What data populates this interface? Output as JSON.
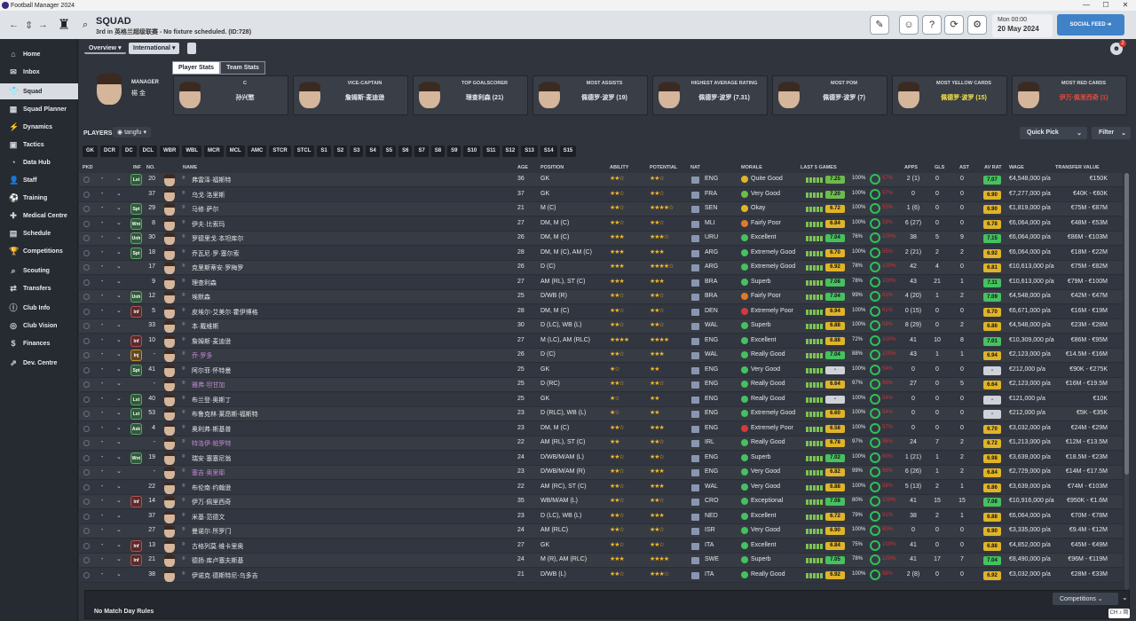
{
  "window": {
    "title": "Football Manager 2024",
    "minimize": "—",
    "maximize": "☐",
    "close": "✕"
  },
  "topbar": {
    "section": "SQUAD",
    "subtitle": "3rd in 英格兰超级联赛 - No fixture scheduled. (ID:728)",
    "date_line1": "Mon 00:00",
    "date_line2": "20 May 2024",
    "social_feed": "SOCIAL FEED"
  },
  "sidebar": {
    "items": [
      {
        "label": "Home",
        "icon": "home-icon"
      },
      {
        "label": "Inbox",
        "icon": "inbox-icon"
      },
      {
        "label": "Squad",
        "icon": "shirt-icon"
      },
      {
        "label": "Squad Planner",
        "icon": "planner-icon"
      },
      {
        "label": "Dynamics",
        "icon": "dynamics-icon"
      },
      {
        "label": "Tactics",
        "icon": "tactics-icon"
      },
      {
        "label": "Data Hub",
        "icon": "data-hub-icon"
      },
      {
        "label": "Staff",
        "icon": "staff-icon"
      },
      {
        "label": "Training",
        "icon": "training-icon"
      },
      {
        "label": "Medical Centre",
        "icon": "medical-icon"
      },
      {
        "label": "Schedule",
        "icon": "calendar-icon"
      },
      {
        "label": "Competitions",
        "icon": "trophy-icon"
      },
      {
        "label": "Scouting",
        "icon": "scouting-icon"
      },
      {
        "label": "Transfers",
        "icon": "transfers-icon"
      },
      {
        "label": "Club Info",
        "icon": "club-info-icon"
      },
      {
        "label": "Club Vision",
        "icon": "vision-icon"
      },
      {
        "label": "Finances",
        "icon": "finances-icon"
      },
      {
        "label": "Dev. Centre",
        "icon": "dev-centre-icon"
      }
    ],
    "active": "Squad"
  },
  "tabs": {
    "overview": "Overview",
    "international": "International"
  },
  "notifications": {
    "count": "2"
  },
  "manager": {
    "label": "MANAGER",
    "name": "楊 金"
  },
  "stat_tabs": {
    "player_stats": "Player Stats",
    "team_stats": "Team Stats"
  },
  "cards": [
    {
      "title": "C",
      "value": "孙兴慜",
      "color": "#e6e8ec"
    },
    {
      "title": "VICE-CAPTAIN",
      "value": "詹姆斯·麦迪逊",
      "color": "#e6e8ec"
    },
    {
      "title": "TOP GOALSCORER",
      "value": "理查利森 (21)",
      "color": "#e6e8ec"
    },
    {
      "title": "MOST ASSISTS",
      "value": "佩德罗·波罗 (19)",
      "color": "#e6e8ec"
    },
    {
      "title": "HIGHEST AVERAGE RATING",
      "value": "佩德罗·波罗 (7.31)",
      "color": "#e6e8ec"
    },
    {
      "title": "MOST POM",
      "value": "佩德罗·波罗 (7)",
      "color": "#e6e8ec"
    },
    {
      "title": "MOST YELLOW CARDS",
      "value": "佩德罗·波罗 (15)",
      "color": "#f2e24a"
    },
    {
      "title": "MOST RED CARDS",
      "value": "伊万·佩里西奇 (1)",
      "color": "#e24a3f"
    }
  ],
  "players_label": "PLAYERS",
  "players_view": "tangfu",
  "quick_pick": "Quick Pick",
  "filter": "Filter",
  "position_filters": [
    "GK",
    "DCR",
    "DC",
    "DCL",
    "WBR",
    "WBL",
    "MCR",
    "MCL",
    "AMC",
    "STCR",
    "STCL",
    "S1",
    "S2",
    "S3",
    "S4",
    "S5",
    "S6",
    "S7",
    "S8",
    "S9",
    "S10",
    "S11",
    "S12",
    "S13",
    "S14",
    "S15"
  ],
  "columns": {
    "pkd": "PKD",
    "inf": "INF",
    "no": "NO.",
    "name": "NAME",
    "age": "AGE",
    "position": "POSITION",
    "ability": "ABILITY",
    "potential": "POTENTIAL",
    "nat": "NAT",
    "morale": "MORALE",
    "last5": "LAST 5 GAMES",
    "apps": "APPS",
    "gls": "GLS",
    "ast": "AST",
    "avrat": "AV RAT",
    "wage": "WAGE",
    "tval": "TRANSFER VALUE"
  },
  "players": [
    {
      "inf": "Lst",
      "infc": "g",
      "no": "20",
      "name": "弗雷泽·福斯特",
      "link": false,
      "age": "36",
      "pos": "GK",
      "abil": "★★☆",
      "pot": "★★☆",
      "nat": "ENG",
      "morale": "Quite Good",
      "mc": "#e0b429",
      "l5": "7.25",
      "l5c": "#6dbb4c",
      "p1": "100%",
      "p2": "57%",
      "apps": "2 (1)",
      "gls": "0",
      "ast": "0",
      "avrat": "7.07",
      "arc": "#45c160",
      "wage": "€4,548,000 p/a",
      "tval": "€150K"
    },
    {
      "inf": "",
      "infc": "",
      "no": "37",
      "name": "乌戈·洛里斯",
      "link": false,
      "age": "37",
      "pos": "GK",
      "abil": "★★☆",
      "pot": "★★☆",
      "nat": "FRA",
      "morale": "Very Good",
      "mc": "#6dbb4c",
      "l5": "7.20",
      "l5c": "#6dbb4c",
      "p1": "100%",
      "p2": "57%",
      "apps": "0",
      "gls": "0",
      "ast": "0",
      "avrat": "6.90",
      "arc": "#e0b429",
      "wage": "€7,277,000 p/a",
      "tval": "€40K - €60K"
    },
    {
      "inf": "Spt",
      "infc": "g",
      "no": "29",
      "name": "马修·萨尔",
      "link": false,
      "age": "21",
      "pos": "M (C)",
      "abil": "★★☆",
      "pot": "★★★★☆",
      "nat": "SEN",
      "morale": "Okay",
      "mc": "#e0b429",
      "l5": "6.72",
      "l5c": "#e0b429",
      "p1": "100%",
      "p2": "55%",
      "apps": "1 (6)",
      "gls": "0",
      "ast": "0",
      "avrat": "6.90",
      "arc": "#e0b429",
      "wage": "€1,819,000 p/a",
      "tval": "€75M - €87M"
    },
    {
      "inf": "Wnt",
      "infc": "g",
      "no": "8",
      "name": "伊夫·比索玛",
      "link": false,
      "age": "27",
      "pos": "DM, M (C)",
      "abil": "★★☆",
      "pot": "★★☆",
      "nat": "MLI",
      "morale": "Fairly Poor",
      "mc": "#e07a2a",
      "l5": "6.84",
      "l5c": "#e0b429",
      "p1": "100%",
      "p2": "59%",
      "apps": "6 (27)",
      "gls": "0",
      "ast": "0",
      "avrat": "6.78",
      "arc": "#e0b429",
      "wage": "€6,064,000 p/a",
      "tval": "€48M - €53M"
    },
    {
      "inf": "Unh",
      "infc": "g",
      "no": "30",
      "name": "罗德里戈·本坦库尔",
      "link": false,
      "age": "26",
      "pos": "DM, M (C)",
      "abil": "★★★",
      "pot": "★★★☆",
      "nat": "URU",
      "morale": "Excellent",
      "mc": "#45c160",
      "l5": "7.04",
      "l5c": "#45c160",
      "p1": "76%",
      "p2": "100%",
      "apps": "38",
      "gls": "5",
      "ast": "9",
      "avrat": "7.15",
      "arc": "#45c160",
      "wage": "€6,064,000 p/a",
      "tval": "€86M - €103M"
    },
    {
      "inf": "Spt",
      "infc": "g",
      "no": "18",
      "name": "乔瓦尼·罗·塞尔索",
      "link": false,
      "age": "28",
      "pos": "DM, M (C), AM (C)",
      "abil": "★★★",
      "pot": "★★★",
      "nat": "ARG",
      "morale": "Extremely Good",
      "mc": "#45c160",
      "l5": "6.70",
      "l5c": "#e0b429",
      "p1": "100%",
      "p2": "55%",
      "apps": "2 (21)",
      "gls": "2",
      "ast": "2",
      "avrat": "6.92",
      "arc": "#e0b429",
      "wage": "€6,064,000 p/a",
      "tval": "€18M - €22M"
    },
    {
      "inf": "",
      "infc": "",
      "no": "17",
      "name": "克里斯蒂安·罗梅罗",
      "link": false,
      "age": "26",
      "pos": "D (C)",
      "abil": "★★★",
      "pot": "★★★★☆",
      "nat": "ARG",
      "morale": "Extremely Good",
      "mc": "#45c160",
      "l5": "6.92",
      "l5c": "#e0b429",
      "p1": "78%",
      "p2": "100%",
      "apps": "42",
      "gls": "4",
      "ast": "0",
      "avrat": "6.81",
      "arc": "#e0b429",
      "wage": "€10,613,000 p/a",
      "tval": "€75M - €82M"
    },
    {
      "inf": "",
      "infc": "",
      "no": "9",
      "name": "理查利森",
      "link": false,
      "age": "27",
      "pos": "AM (RL), ST (C)",
      "abil": "★★★",
      "pot": "★★★",
      "nat": "BRA",
      "morale": "Superb",
      "mc": "#45c160",
      "l5": "7.08",
      "l5c": "#45c160",
      "p1": "78%",
      "p2": "100%",
      "apps": "43",
      "gls": "21",
      "ast": "1",
      "avrat": "7.11",
      "arc": "#45c160",
      "wage": "€10,613,000 p/a",
      "tval": "€79M - €100M"
    },
    {
      "inf": "Unh",
      "infc": "g",
      "no": "12",
      "name": "埃默森",
      "link": false,
      "age": "25",
      "pos": "D/WB (R)",
      "abil": "★★☆",
      "pot": "★★☆",
      "nat": "BRA",
      "morale": "Fairly Poor",
      "mc": "#e07a2a",
      "l5": "7.04",
      "l5c": "#45c160",
      "p1": "99%",
      "p2": "61%",
      "apps": "4 (20)",
      "gls": "1",
      "ast": "2",
      "avrat": "7.09",
      "arc": "#45c160",
      "wage": "€4,548,000 p/a",
      "tval": "€42M - €47M"
    },
    {
      "inf": "Inf",
      "infc": "r",
      "no": "5",
      "name": "皮埃尔-艾美尔·霍伊博格",
      "link": false,
      "age": "28",
      "pos": "DM, M (C)",
      "abil": "★★☆",
      "pot": "★★☆",
      "nat": "DEN",
      "morale": "Extremely Poor",
      "mc": "#d23b3b",
      "l5": "6.94",
      "l5c": "#e0b429",
      "p1": "100%",
      "p2": "61%",
      "apps": "0 (15)",
      "gls": "0",
      "ast": "0",
      "avrat": "6.70",
      "arc": "#e0b429",
      "wage": "€6,671,000 p/a",
      "tval": "€16M - €19M"
    },
    {
      "inf": "",
      "infc": "",
      "no": "33",
      "name": "本·戴维斯",
      "link": false,
      "age": "30",
      "pos": "D (LC), WB (L)",
      "abil": "★★☆",
      "pot": "★★☆",
      "nat": "WAL",
      "morale": "Superb",
      "mc": "#45c160",
      "l5": "6.88",
      "l5c": "#e0b429",
      "p1": "100%",
      "p2": "59%",
      "apps": "8 (29)",
      "gls": "0",
      "ast": "2",
      "avrat": "6.86",
      "arc": "#e0b429",
      "wage": "€4,548,000 p/a",
      "tval": "€23M - €28M"
    },
    {
      "inf": "Inf",
      "infc": "r",
      "no": "10",
      "name": "詹姆斯·麦迪逊",
      "link": false,
      "age": "27",
      "pos": "M (LC), AM (RLC)",
      "abil": "★★★★",
      "pot": "★★★★",
      "nat": "ENG",
      "morale": "Excellent",
      "mc": "#45c160",
      "l5": "6.88",
      "l5c": "#e0b429",
      "p1": "72%",
      "p2": "100%",
      "apps": "41",
      "gls": "10",
      "ast": "8",
      "avrat": "7.01",
      "arc": "#45c160",
      "wage": "€10,309,000 p/a",
      "tval": "€86M - €95M"
    },
    {
      "inf": "Inj",
      "infc": "o",
      "no": "-",
      "name": "乔·罗多",
      "link": true,
      "age": "26",
      "pos": "D (C)",
      "abil": "★★☆",
      "pot": "★★★",
      "nat": "WAL",
      "morale": "Really Good",
      "mc": "#45c160",
      "l5": "7.04",
      "l5c": "#45c160",
      "p1": "88%",
      "p2": "100%",
      "apps": "43",
      "gls": "1",
      "ast": "1",
      "avrat": "6.94",
      "arc": "#e0b429",
      "wage": "€2,123,000 p/a",
      "tval": "€14.5M - €16M"
    },
    {
      "inf": "Spt",
      "infc": "g",
      "no": "41",
      "name": "阿尔菲·怀特曼",
      "link": false,
      "age": "25",
      "pos": "GK",
      "abil": "★☆",
      "pot": "★★",
      "nat": "ENG",
      "morale": "Very Good",
      "mc": "#45c160",
      "l5": "-",
      "l5c": "#cfd3d9",
      "p1": "100%",
      "p2": "54%",
      "apps": "0",
      "gls": "0",
      "ast": "0",
      "avrat": "-",
      "arc": "#cfd3d9",
      "wage": "€212,000 p/a",
      "tval": "€90K - €275K"
    },
    {
      "inf": "",
      "infc": "",
      "no": "-",
      "name": "雅弗·坦甘加",
      "link": true,
      "age": "25",
      "pos": "D (RC)",
      "abil": "★★☆",
      "pot": "★★☆",
      "nat": "ENG",
      "morale": "Really Good",
      "mc": "#45c160",
      "l5": "6.64",
      "l5c": "#e0b429",
      "p1": "97%",
      "p2": "96%",
      "apps": "27",
      "gls": "0",
      "ast": "5",
      "avrat": "6.64",
      "arc": "#e0b429",
      "wage": "€2,123,000 p/a",
      "tval": "€16M - €19.5M"
    },
    {
      "inf": "Lst",
      "infc": "g",
      "no": "40",
      "name": "布兰登·奥斯丁",
      "link": false,
      "age": "25",
      "pos": "GK",
      "abil": "★☆",
      "pot": "★★",
      "nat": "ENG",
      "morale": "Really Good",
      "mc": "#45c160",
      "l5": "-",
      "l5c": "#cfd3d9",
      "p1": "100%",
      "p2": "54%",
      "apps": "0",
      "gls": "0",
      "ast": "0",
      "avrat": "-",
      "arc": "#cfd3d9",
      "wage": "€121,000 p/a",
      "tval": "€10K"
    },
    {
      "inf": "Lst",
      "infc": "g",
      "no": "53",
      "name": "布鲁克林·莱昂斯-福斯特",
      "link": false,
      "age": "23",
      "pos": "D (RLC), WB (L)",
      "abil": "★☆",
      "pot": "★★",
      "nat": "ENG",
      "morale": "Extremely Good",
      "mc": "#45c160",
      "l5": "6.60",
      "l5c": "#e0b429",
      "p1": "100%",
      "p2": "54%",
      "apps": "0",
      "gls": "0",
      "ast": "0",
      "avrat": "-",
      "arc": "#cfd3d9",
      "wage": "€212,000 p/a",
      "tval": "€5K - €35K"
    },
    {
      "inf": "Ask",
      "infc": "g",
      "no": "4",
      "name": "奥利弗·斯基普",
      "link": false,
      "age": "23",
      "pos": "DM, M (C)",
      "abil": "★★☆",
      "pot": "★★★",
      "nat": "ENG",
      "morale": "Extremely Poor",
      "mc": "#d23b3b",
      "l5": "6.58",
      "l5c": "#e0b429",
      "p1": "100%",
      "p2": "57%",
      "apps": "0",
      "gls": "0",
      "ast": "0",
      "avrat": "6.70",
      "arc": "#e0b429",
      "wage": "€3,032,000 p/a",
      "tval": "€24M - €29M"
    },
    {
      "inf": "",
      "infc": "",
      "no": "-",
      "name": "特洛伊·帕罗特",
      "link": true,
      "age": "22",
      "pos": "AM (RL), ST (C)",
      "abil": "★★",
      "pot": "★★☆",
      "nat": "IRL",
      "morale": "Really Good",
      "mc": "#45c160",
      "l5": "6.78",
      "l5c": "#e0b429",
      "p1": "97%",
      "p2": "96%",
      "apps": "24",
      "gls": "7",
      "ast": "2",
      "avrat": "6.72",
      "arc": "#e0b429",
      "wage": "€1,213,000 p/a",
      "tval": "€12M - €13.5M"
    },
    {
      "inf": "Wnt",
      "infc": "g",
      "no": "19",
      "name": "瑞安·塞塞尼翁",
      "link": false,
      "age": "24",
      "pos": "D/WB/M/AM (L)",
      "abil": "★★☆",
      "pot": "★★☆",
      "nat": "ENG",
      "morale": "Superb",
      "mc": "#45c160",
      "l5": "7.02",
      "l5c": "#45c160",
      "p1": "100%",
      "p2": "60%",
      "apps": "1 (21)",
      "gls": "1",
      "ast": "2",
      "avrat": "6.98",
      "arc": "#e0b429",
      "wage": "€3,639,000 p/a",
      "tval": "€18.5M - €23M"
    },
    {
      "inf": "",
      "infc": "",
      "no": "-",
      "name": "塞吉·奥里耶",
      "link": true,
      "age": "23",
      "pos": "D/WB/M/AM (R)",
      "abil": "★★☆",
      "pot": "★★★",
      "nat": "ENG",
      "morale": "Very Good",
      "mc": "#45c160",
      "l5": "6.82",
      "l5c": "#e0b429",
      "p1": "99%",
      "p2": "96%",
      "apps": "6 (26)",
      "gls": "1",
      "ast": "2",
      "avrat": "6.84",
      "arc": "#e0b429",
      "wage": "€2,729,000 p/a",
      "tval": "€14M - €17.5M"
    },
    {
      "inf": "",
      "infc": "",
      "no": "22",
      "name": "布伦南·约翰逊",
      "link": false,
      "age": "22",
      "pos": "AM (RC), ST (C)",
      "abil": "★★☆",
      "pot": "★★★",
      "nat": "WAL",
      "morale": "Very Good",
      "mc": "#45c160",
      "l5": "6.88",
      "l5c": "#e0b429",
      "p1": "100%",
      "p2": "58%",
      "apps": "5 (13)",
      "gls": "2",
      "ast": "1",
      "avrat": "6.86",
      "arc": "#e0b429",
      "wage": "€3,639,000 p/a",
      "tval": "€74M - €103M"
    },
    {
      "inf": "Inf",
      "infc": "r",
      "no": "14",
      "name": "伊万·佩里西奇",
      "link": false,
      "age": "35",
      "pos": "WB/M/AM (L)",
      "abil": "★★☆",
      "pot": "★★☆",
      "nat": "CRO",
      "morale": "Exceptional",
      "mc": "#45c160",
      "l5": "7.08",
      "l5c": "#45c160",
      "p1": "80%",
      "p2": "100%",
      "apps": "41",
      "gls": "15",
      "ast": "15",
      "avrat": "7.08",
      "arc": "#45c160",
      "wage": "€10,916,000 p/a",
      "tval": "€950K - €1.6M"
    },
    {
      "inf": "",
      "infc": "",
      "no": "37",
      "name": "米基·范德文",
      "link": false,
      "age": "23",
      "pos": "D (LC), WB (L)",
      "abil": "★★☆",
      "pot": "★★★",
      "nat": "NED",
      "morale": "Excellent",
      "mc": "#45c160",
      "l5": "6.72",
      "l5c": "#e0b429",
      "p1": "79%",
      "p2": "91%",
      "apps": "38",
      "gls": "2",
      "ast": "1",
      "avrat": "6.88",
      "arc": "#e0b429",
      "wage": "€6,064,000 p/a",
      "tval": "€70M - €78M"
    },
    {
      "inf": "",
      "infc": "",
      "no": "27",
      "name": "曼诺尔·所罗门",
      "link": false,
      "age": "24",
      "pos": "AM (RLC)",
      "abil": "★★☆",
      "pot": "★★☆",
      "nat": "ISR",
      "morale": "Very Good",
      "mc": "#45c160",
      "l5": "6.90",
      "l5c": "#e0b429",
      "p1": "100%",
      "p2": "60%",
      "apps": "0",
      "gls": "0",
      "ast": "0",
      "avrat": "6.90",
      "arc": "#e0b429",
      "wage": "€3,335,000 p/a",
      "tval": "€9.4M - €12M"
    },
    {
      "inf": "Inf",
      "infc": "r",
      "no": "13",
      "name": "古格列莫·维卡里奥",
      "link": false,
      "age": "27",
      "pos": "GK",
      "abil": "★★☆",
      "pot": "★★☆",
      "nat": "ITA",
      "morale": "Excellent",
      "mc": "#45c160",
      "l5": "6.84",
      "l5c": "#e0b429",
      "p1": "75%",
      "p2": "100%",
      "apps": "41",
      "gls": "0",
      "ast": "0",
      "avrat": "6.88",
      "arc": "#e0b429",
      "wage": "€4,852,000 p/a",
      "tval": "€45M - €49M"
    },
    {
      "inf": "Inf",
      "infc": "r",
      "no": "21",
      "name": "德扬·库卢塞夫斯基",
      "link": false,
      "age": "24",
      "pos": "M (R), AM (RLC)",
      "abil": "★★★",
      "pot": "★★★★",
      "nat": "SWE",
      "morale": "Superb",
      "mc": "#45c160",
      "l5": "7.05",
      "l5c": "#45c160",
      "p1": "78%",
      "p2": "100%",
      "apps": "41",
      "gls": "17",
      "ast": "7",
      "avrat": "7.04",
      "arc": "#45c160",
      "wage": "€8,490,000 p/a",
      "tval": "€96M - €119M"
    },
    {
      "inf": "",
      "infc": "",
      "no": "38",
      "name": "伊诺克·德斯特尼-乌多吉",
      "link": false,
      "age": "21",
      "pos": "D/WB (L)",
      "abil": "★★☆",
      "pot": "★★★☆",
      "nat": "ITA",
      "morale": "Really Good",
      "mc": "#45c160",
      "l5": "6.92",
      "l5c": "#e0b429",
      "p1": "100%",
      "p2": "56%",
      "apps": "2 (8)",
      "gls": "0",
      "ast": "0",
      "avrat": "6.92",
      "arc": "#e0b429",
      "wage": "€3,032,000 p/a",
      "tval": "€28M - €33M"
    }
  ],
  "bottom": {
    "match_day_rules": "No Match Day Rules",
    "competitions": "Competitions"
  },
  "ime": "CH ♪ 简"
}
